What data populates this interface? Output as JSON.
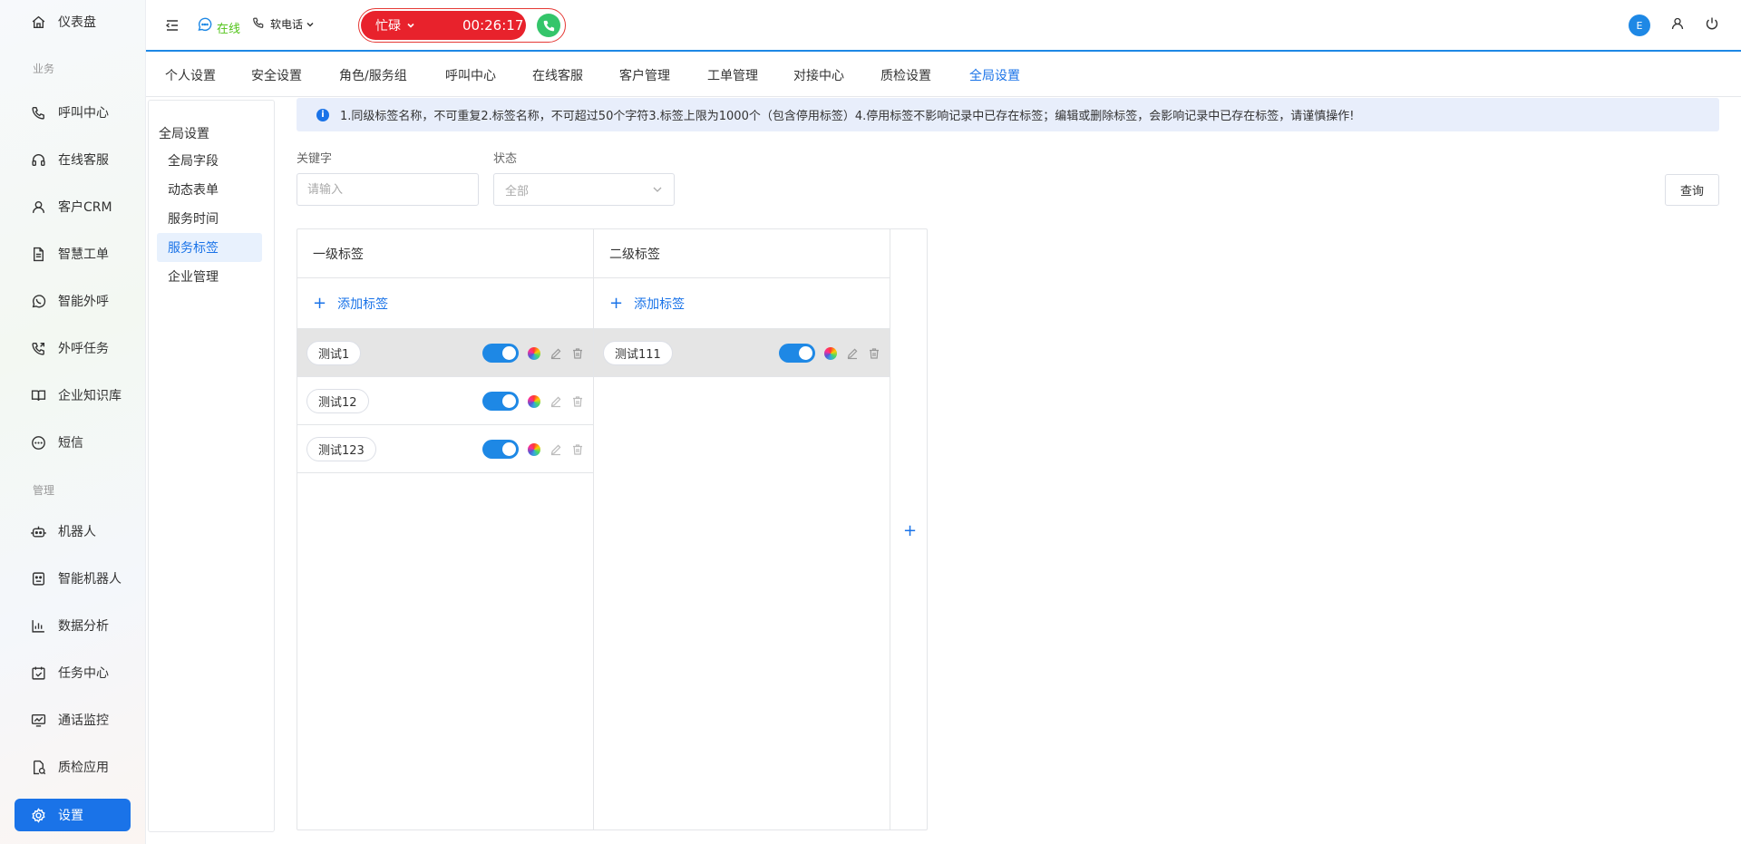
{
  "sidebar": {
    "sections": [
      "业务",
      "管理"
    ],
    "items": [
      {
        "label": "仪表盘",
        "icon": "home-icon"
      },
      {
        "label": "呼叫中心",
        "icon": "phone-icon"
      },
      {
        "label": "在线客服",
        "icon": "headset-icon"
      },
      {
        "label": "客户CRM",
        "icon": "user-icon"
      },
      {
        "label": "智慧工单",
        "icon": "document-icon"
      },
      {
        "label": "智能外呼",
        "icon": "whatsapp-icon"
      },
      {
        "label": "外呼任务",
        "icon": "phone-out-icon"
      },
      {
        "label": "企业知识库",
        "icon": "book-icon"
      },
      {
        "label": "短信",
        "icon": "sms-icon"
      },
      {
        "label": "机器人",
        "icon": "robot-icon"
      },
      {
        "label": "智能机器人",
        "icon": "smart-robot-icon"
      },
      {
        "label": "数据分析",
        "icon": "bar-chart-icon"
      },
      {
        "label": "任务中心",
        "icon": "task-check-icon"
      },
      {
        "label": "通话监控",
        "icon": "monitor-chart-icon"
      },
      {
        "label": "质检应用",
        "icon": "quality-check-icon"
      },
      {
        "label": "设置",
        "icon": "settings-icon"
      }
    ],
    "active": "设置"
  },
  "topbar": {
    "status_label": "在线",
    "phone_label": "软电话",
    "call_status": "忙碌",
    "call_timer": "00:26:17",
    "avatar_letter": "E"
  },
  "tabs": [
    "个人设置",
    "安全设置",
    "角色/服务组",
    "呼叫中心",
    "在线客服",
    "客户管理",
    "工单管理",
    "对接中心",
    "质检设置",
    "全局设置"
  ],
  "active_tab": "全局设置",
  "subnav": {
    "title": "全局设置",
    "items": [
      "全局字段",
      "动态表单",
      "服务时间",
      "服务标签",
      "企业管理"
    ],
    "active": "服务标签"
  },
  "banner": {
    "text": "1.同级标签名称，不可重复2.标签名称，不可超过50个字符3.标签上限为1000个（包含停用标签）4.停用标签不影响记录中已存在标签；编辑或删除标签，会影响记录中已存在标签，请谨慎操作!"
  },
  "filters": {
    "keyword_label": "关键字",
    "keyword_placeholder": "请输入",
    "status_label": "状态",
    "status_value": "全部",
    "query_label": "查询"
  },
  "tag_board": {
    "level1": {
      "header": "一级标签",
      "add_label": "添加标签",
      "tags": [
        {
          "name": "测试1",
          "enabled": true,
          "selected": true
        },
        {
          "name": "测试12",
          "enabled": true,
          "selected": false
        },
        {
          "name": "测试123",
          "enabled": true,
          "selected": false
        }
      ]
    },
    "level2": {
      "header": "二级标签",
      "add_label": "添加标签",
      "tags": [
        {
          "name": "测试111",
          "enabled": true,
          "selected": true
        }
      ]
    },
    "add_column_label": "+"
  },
  "colors": {
    "primary": "#1a73e8",
    "busy_red": "#e8222c",
    "online_green": "#52c41a",
    "banner_bg": "#e8eefb"
  }
}
